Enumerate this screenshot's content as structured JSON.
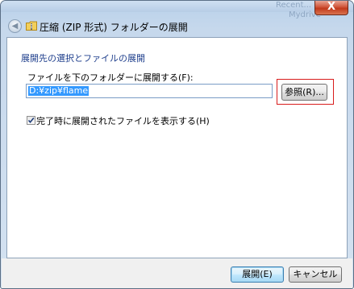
{
  "window": {
    "close_glyph": "X",
    "background_title_hint": "Mydrive",
    "background_title_hint_faded": "Recent..."
  },
  "header": {
    "back_icon": "back-arrow-icon",
    "app_icon": "zip-folder-icon",
    "title": "圧縮 (ZIP 形式) フォルダーの展開"
  },
  "main": {
    "section_title": "展開先の選択とファイルの展開",
    "destination_label": "ファイルを下のフォルダーに展開する(F):",
    "destination_value": "D:¥zip¥flame",
    "browse_button": "参照(R)...",
    "show_files_label": "完了時に展開されたファイルを表示する(H)",
    "show_files_checked": true
  },
  "footer": {
    "extract_button": "展開(E)",
    "cancel_button": "キャンセル"
  },
  "colors": {
    "accent_blue": "#1e3e8c",
    "selection": "#3399ff",
    "highlight_border": "#d81c1c",
    "close_button": "#c23a1c"
  }
}
